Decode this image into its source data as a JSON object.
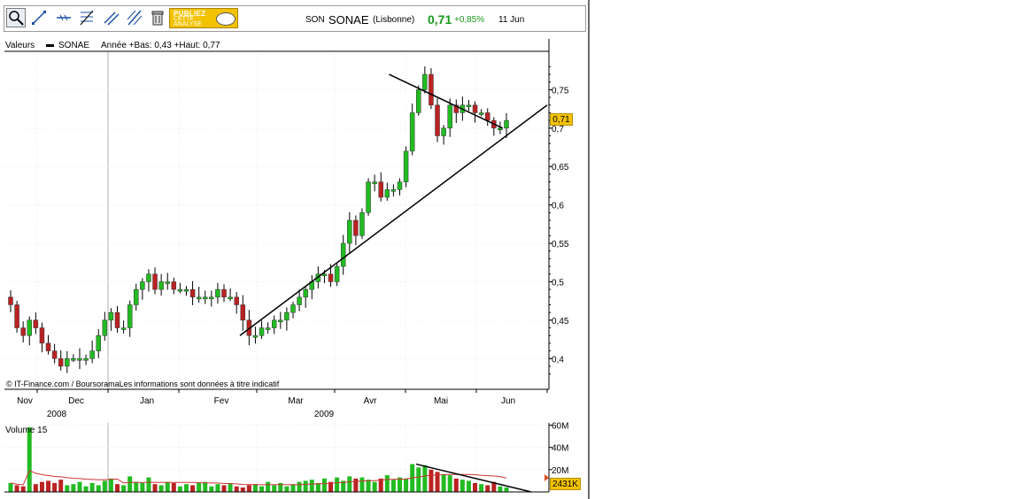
{
  "quote": {
    "ticker": "SON",
    "name": "SONAE",
    "market": "(Lisbonne)",
    "last": "0,71",
    "change": "+0,85%",
    "date": "11 Jun"
  },
  "toolbar": {
    "publish_line1": "PUBLIEZ",
    "publish_line2": "CETTE",
    "publish_line3": "ANALYSE"
  },
  "legend": {
    "label": "Valeurs",
    "series": "SONAE",
    "info": "Année +Bas: 0,43 +Haut: 0,77"
  },
  "price_panel": {
    "last_badge": "0,71",
    "credit": "© IT-Finance.com / BoursoramaLes informations sont données à titre indicatif"
  },
  "volume_panel": {
    "title": "Volume 15",
    "last_badge": "2431K"
  },
  "colors": {
    "up": "#22bb22",
    "down": "#bb2222",
    "badge": "#f2c200",
    "avg_line": "#cc3333"
  },
  "chart_data": [
    {
      "type": "candlestick",
      "title": "SONAE",
      "ylim": [
        0.36,
        0.8
      ],
      "y_ticks": [
        "0,4",
        "0,45",
        "0,5",
        "0,55",
        "0,6",
        "0,65",
        "0,7",
        "0,75"
      ],
      "y_tick_values": [
        0.4,
        0.45,
        0.5,
        0.55,
        0.6,
        0.65,
        0.7,
        0.75
      ],
      "x_ticks": [
        "Nov",
        "Dec",
        "Jan",
        "Fev",
        "Mar",
        "Avr",
        "Mai",
        "Jun"
      ],
      "year_labels": [
        "2008",
        "2009"
      ],
      "close_path": [
        0.47,
        0.44,
        0.43,
        0.45,
        0.44,
        0.42,
        0.41,
        0.4,
        0.39,
        0.4,
        0.4,
        0.4,
        0.4,
        0.41,
        0.43,
        0.45,
        0.46,
        0.44,
        0.44,
        0.47,
        0.49,
        0.5,
        0.51,
        0.49,
        0.5,
        0.5,
        0.49,
        0.49,
        0.49,
        0.48,
        0.48,
        0.48,
        0.48,
        0.49,
        0.48,
        0.48,
        0.47,
        0.45,
        0.43,
        0.43,
        0.44,
        0.44,
        0.45,
        0.45,
        0.46,
        0.47,
        0.48,
        0.49,
        0.5,
        0.51,
        0.51,
        0.5,
        0.52,
        0.55,
        0.58,
        0.56,
        0.59,
        0.63,
        0.63,
        0.61,
        0.62,
        0.62,
        0.63,
        0.67,
        0.72,
        0.75,
        0.77,
        0.73,
        0.69,
        0.7,
        0.73,
        0.72,
        0.73,
        0.73,
        0.72,
        0.72,
        0.71,
        0.7,
        0.7,
        0.71
      ],
      "trendlines": [
        {
          "from": [
            "2009-02-12",
            0.43
          ],
          "to": [
            "2009-06-30",
            0.73
          ]
        },
        {
          "from": [
            "2009-04-20",
            0.77
          ],
          "to": [
            "2009-06-10",
            0.7
          ]
        }
      ]
    },
    {
      "type": "bar",
      "title": "Volume 15",
      "y_ticks": [
        "20M",
        "40M",
        "60M"
      ],
      "y_tick_values": [
        20,
        40,
        60
      ],
      "ylim": [
        0,
        62
      ],
      "unit": "M",
      "values": [
        8,
        6,
        5,
        58,
        7,
        9,
        10,
        8,
        11,
        6,
        7,
        9,
        5,
        8,
        6,
        10,
        12,
        7,
        6,
        14,
        9,
        8,
        13,
        7,
        6,
        9,
        8,
        5,
        7,
        6,
        8,
        9,
        5,
        7,
        6,
        8,
        5,
        4,
        6,
        7,
        5,
        9,
        6,
        8,
        5,
        7,
        9,
        10,
        11,
        8,
        12,
        9,
        13,
        10,
        14,
        12,
        13,
        11,
        9,
        12,
        15,
        11,
        13,
        12,
        25,
        22,
        24,
        20,
        18,
        16,
        15,
        12,
        11,
        10,
        8,
        7,
        6,
        9,
        5,
        4
      ]
    }
  ]
}
